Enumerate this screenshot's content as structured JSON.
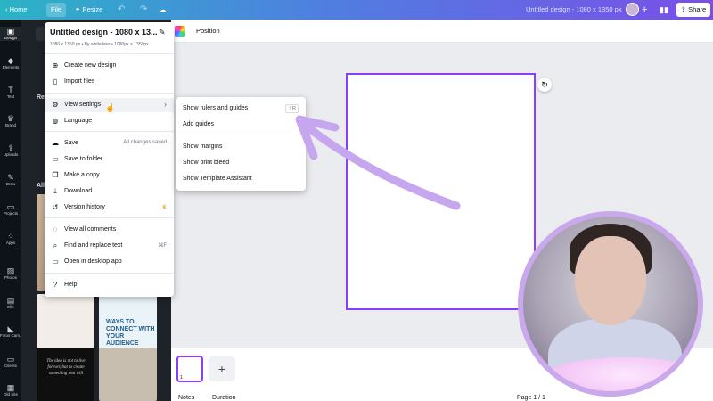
{
  "topbar": {
    "home": "Home",
    "file": "File",
    "resize": "Resize",
    "title": "Untitled design - 1080 x 1350 px",
    "share": "Share"
  },
  "rail": [
    {
      "label": "Design",
      "icon": "layout-icon"
    },
    {
      "label": "Elements",
      "icon": "shapes-icon"
    },
    {
      "label": "Text",
      "icon": "text-icon"
    },
    {
      "label": "Brand",
      "icon": "crown-icon"
    },
    {
      "label": "Uploads",
      "icon": "upload-icon"
    },
    {
      "label": "Draw",
      "icon": "pen-icon"
    },
    {
      "label": "Projects",
      "icon": "folder-icon"
    },
    {
      "label": "Apps",
      "icon": "apps-icon"
    },
    {
      "label": "Photos",
      "icon": "image-icon"
    },
    {
      "label": "Elle",
      "icon": "app-icon"
    },
    {
      "label": "Fotos Cam...",
      "icon": "app-icon"
    },
    {
      "label": "Clients",
      "icon": "folder-icon"
    },
    {
      "label": "Old Site",
      "icon": "app-icon"
    }
  ],
  "panel": {
    "recent_label": "Re",
    "all_label": "All",
    "tile_ways_text": "WAYS TO CONNECT WITH YOUR AUDIENCE",
    "tile_quote_text": "The idea is not to live forever, but to create something that will"
  },
  "context_bar": {
    "position": "Position"
  },
  "file_menu": {
    "title": "Untitled design - 1080 x 13...",
    "subtitle": "1080 x 1350 px • By whitedeer • 1080px × 1350px",
    "items": [
      {
        "label": "Create new design",
        "icon": "plus-icon",
        "right": ""
      },
      {
        "label": "Import files",
        "icon": "file-icon",
        "right": ""
      },
      {
        "label": "View settings",
        "icon": "gear-icon",
        "right": "›"
      },
      {
        "label": "Language",
        "icon": "globe-icon",
        "right": ""
      },
      {
        "label": "Save",
        "icon": "cloud-icon",
        "right": "All changes saved"
      },
      {
        "label": "Save to folder",
        "icon": "folder-icon",
        "right": ""
      },
      {
        "label": "Make a copy",
        "icon": "copy-icon",
        "right": ""
      },
      {
        "label": "Download",
        "icon": "download-icon",
        "right": ""
      },
      {
        "label": "Version history",
        "icon": "history-icon",
        "right": "♛"
      },
      {
        "label": "View all comments",
        "icon": "comment-icon",
        "right": ""
      },
      {
        "label": "Find and replace text",
        "icon": "find-icon",
        "right": "⌘F"
      },
      {
        "label": "Open in desktop app",
        "icon": "desktop-icon",
        "right": ""
      },
      {
        "label": "Help",
        "icon": "help-icon",
        "right": ""
      }
    ]
  },
  "view_settings_menu": {
    "items": [
      {
        "label": "Show rulers and guides",
        "shortcut": "⇧R"
      },
      {
        "label": "Add guides",
        "shortcut": ""
      },
      {
        "label": "Show margins",
        "shortcut": ""
      },
      {
        "label": "Show print bleed",
        "shortcut": ""
      },
      {
        "label": "Show Template Assistant",
        "shortcut": ""
      }
    ]
  },
  "bottom_bar": {
    "notes": "Notes",
    "duration": "Duration",
    "page_info": "Page 1 / 1",
    "thumb_number": "1"
  },
  "colors": {
    "accent": "#8b3dff",
    "annotation_arrow": "#c7a6f0",
    "cam_border": "#c9a8ec"
  }
}
